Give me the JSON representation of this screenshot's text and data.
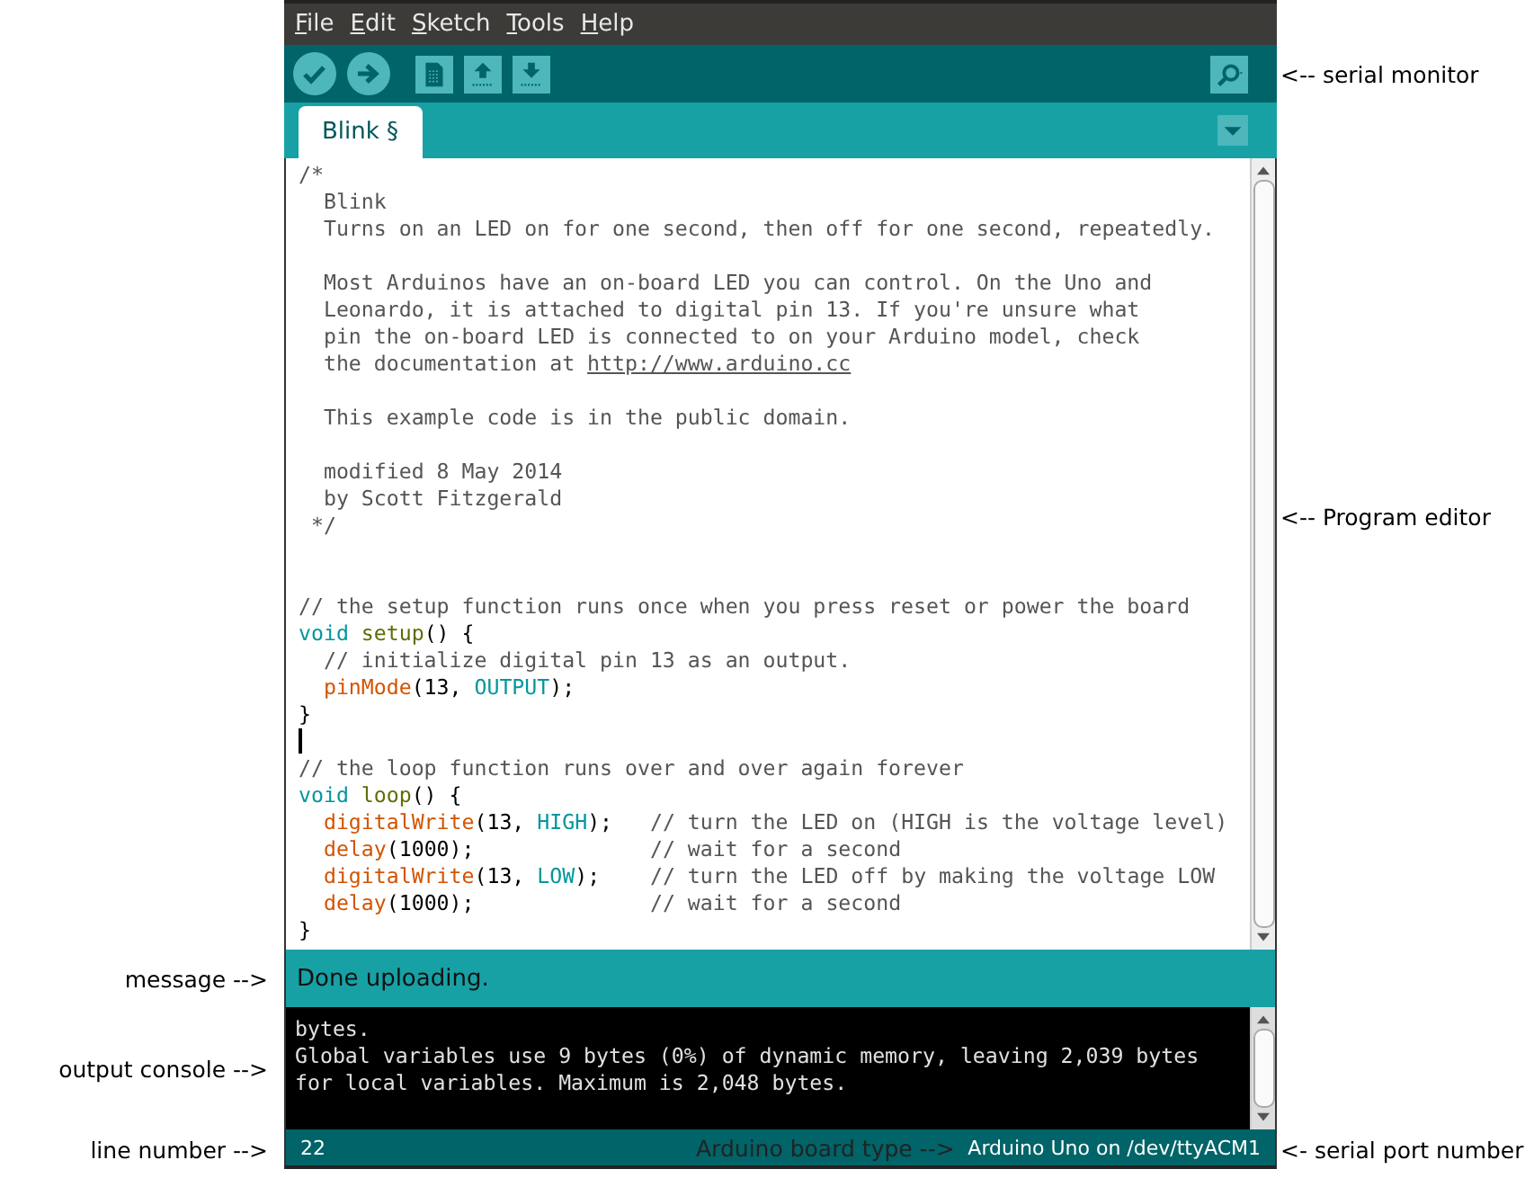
{
  "menu": [
    "File",
    "Edit",
    "Sketch",
    "Tools",
    "Help"
  ],
  "toolbar": [
    {
      "kind": "verify"
    },
    {
      "kind": "upload"
    },
    {
      "kind": "new"
    },
    {
      "kind": "open"
    },
    {
      "kind": "save"
    }
  ],
  "tab": {
    "label": "Blink §",
    "selected": true
  },
  "editor": {
    "lines": [
      {
        "kind": "code",
        "segments": [
          {
            "kind": "comment",
            "text": "/*"
          }
        ]
      },
      {
        "kind": "code",
        "segments": [
          {
            "kind": "comment",
            "text": "  Blink"
          }
        ]
      },
      {
        "kind": "code",
        "segments": [
          {
            "kind": "comment",
            "text": "  Turns on an LED on for one second, then off for one second, repeatedly."
          }
        ]
      },
      {
        "kind": "blank"
      },
      {
        "kind": "code",
        "segments": [
          {
            "kind": "comment",
            "text": "  Most Arduinos have an on-board LED you can control. On the Uno and"
          }
        ]
      },
      {
        "kind": "code",
        "segments": [
          {
            "kind": "comment",
            "text": "  Leonardo, it is attached to digital pin 13. If you're unsure what"
          }
        ]
      },
      {
        "kind": "code",
        "segments": [
          {
            "kind": "comment",
            "text": "  pin the on-board LED is connected to on your Arduino model, check"
          }
        ]
      },
      {
        "kind": "code",
        "segments": [
          {
            "kind": "comment",
            "text": "  the documentation at "
          },
          {
            "kind": "link",
            "text": "http://www.arduino.cc"
          }
        ]
      },
      {
        "kind": "blank"
      },
      {
        "kind": "code",
        "segments": [
          {
            "kind": "comment",
            "text": "  This example code is in the public domain."
          }
        ]
      },
      {
        "kind": "blank"
      },
      {
        "kind": "code",
        "segments": [
          {
            "kind": "comment",
            "text": "  modified 8 May 2014"
          }
        ]
      },
      {
        "kind": "code",
        "segments": [
          {
            "kind": "comment",
            "text": "  by Scott Fitzgerald"
          }
        ]
      },
      {
        "kind": "code",
        "segments": [
          {
            "kind": "comment",
            "text": " */"
          }
        ]
      },
      {
        "kind": "blank"
      },
      {
        "kind": "blank"
      },
      {
        "kind": "code",
        "segments": [
          {
            "kind": "comment",
            "text": "// the setup function runs once when you press reset or power the board"
          }
        ]
      },
      {
        "kind": "code",
        "segments": [
          {
            "kind": "type",
            "text": "void "
          },
          {
            "kind": "name",
            "text": "setup"
          },
          {
            "kind": "plain",
            "text": "() {"
          }
        ]
      },
      {
        "kind": "code",
        "segments": [
          {
            "kind": "comment",
            "text": "  // initialize digital pin 13 as an output."
          }
        ]
      },
      {
        "kind": "code",
        "segments": [
          {
            "kind": "function",
            "text": "  pinMode"
          },
          {
            "kind": "plain",
            "text": "(13, "
          },
          {
            "kind": "constant",
            "text": "OUTPUT"
          },
          {
            "kind": "plain",
            "text": ");"
          }
        ]
      },
      {
        "kind": "code",
        "segments": [
          {
            "kind": "plain",
            "text": "}"
          }
        ]
      },
      {
        "kind": "cursor"
      },
      {
        "kind": "code",
        "segments": [
          {
            "kind": "comment",
            "text": "// the loop function runs over and over again forever"
          }
        ]
      },
      {
        "kind": "code",
        "segments": [
          {
            "kind": "type",
            "text": "void "
          },
          {
            "kind": "name",
            "text": "loop"
          },
          {
            "kind": "plain",
            "text": "() {"
          }
        ]
      },
      {
        "kind": "code",
        "segments": [
          {
            "kind": "function",
            "text": "  digitalWrite"
          },
          {
            "kind": "plain",
            "text": "(13, "
          },
          {
            "kind": "constant",
            "text": "HIGH"
          },
          {
            "kind": "plain",
            "text": ");   "
          },
          {
            "kind": "comment",
            "text": "// turn the LED on (HIGH is the voltage level)"
          }
        ]
      },
      {
        "kind": "code",
        "segments": [
          {
            "kind": "function",
            "text": "  delay"
          },
          {
            "kind": "plain",
            "text": "(1000);              "
          },
          {
            "kind": "comment",
            "text": "// wait for a second"
          }
        ]
      },
      {
        "kind": "code",
        "segments": [
          {
            "kind": "function",
            "text": "  digitalWrite"
          },
          {
            "kind": "plain",
            "text": "(13, "
          },
          {
            "kind": "constant",
            "text": "LOW"
          },
          {
            "kind": "plain",
            "text": ");    "
          },
          {
            "kind": "comment",
            "text": "// turn the LED off by making the voltage LOW"
          }
        ]
      },
      {
        "kind": "code",
        "segments": [
          {
            "kind": "function",
            "text": "  delay"
          },
          {
            "kind": "plain",
            "text": "(1000);              "
          },
          {
            "kind": "comment",
            "text": "// wait for a second"
          }
        ]
      },
      {
        "kind": "code",
        "segments": [
          {
            "kind": "plain",
            "text": "}"
          }
        ]
      }
    ]
  },
  "message": "Done uploading.",
  "console": [
    "bytes.",
    "Global variables use 9 bytes (0%) of dynamic memory, leaving 2,039 bytes",
    "for local variables. Maximum is 2,048 bytes."
  ],
  "status_bar": {
    "line_number": "22",
    "board": "Arduino Uno on /dev/ttyACM1"
  },
  "annotations": {
    "serial_monitor": "<-- serial monitor",
    "program_editor": "<-- Program editor",
    "message": "message -->",
    "output_console": "output console -->",
    "line_number": "line number -->",
    "board_type": "Arduino board type -->",
    "serial_port": "<- serial port number"
  }
}
